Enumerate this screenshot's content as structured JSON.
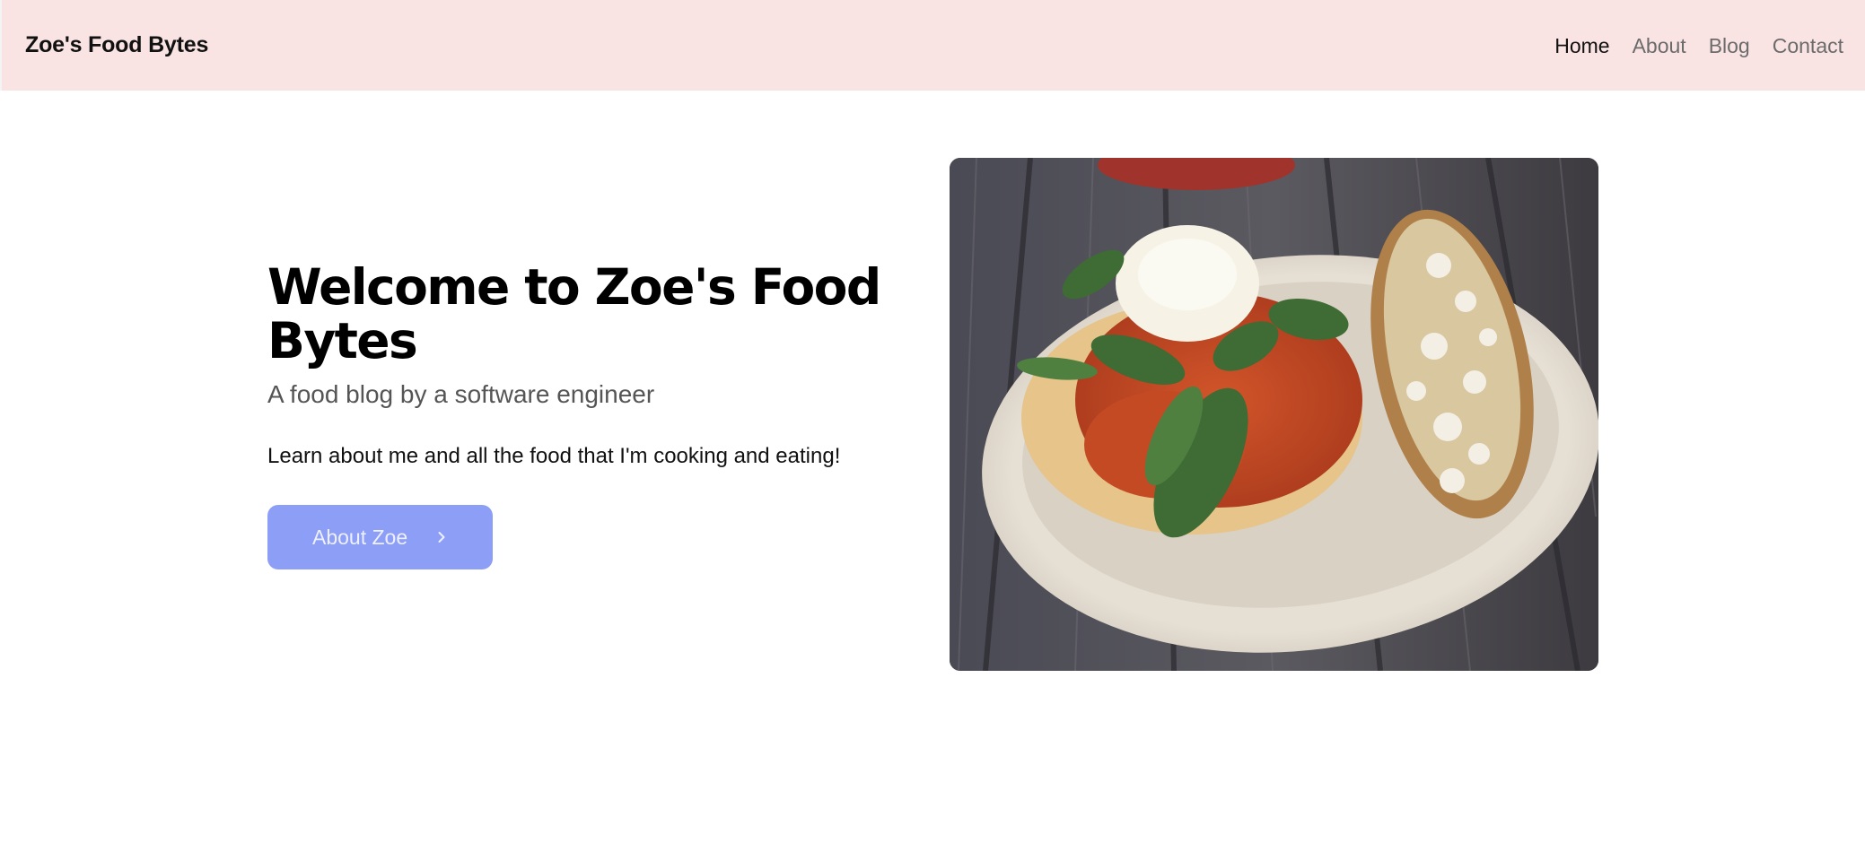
{
  "navbar": {
    "brand": "Zoe's Food Bytes",
    "links": [
      {
        "label": "Home",
        "active": true
      },
      {
        "label": "About",
        "active": false
      },
      {
        "label": "Blog",
        "active": false
      },
      {
        "label": "Contact",
        "active": false
      }
    ]
  },
  "hero": {
    "title": "Welcome to Zoe's Food Bytes",
    "subtitle": "A food blog by a software engineer",
    "lead": "Learn about me and all the food that I'm cooking and eating!",
    "cta_label": "About Zoe",
    "cta_icon": "chevron-right-icon"
  },
  "colors": {
    "navbar_bg": "#f9e4e3",
    "cta_bg": "#8c9ef6",
    "subtitle": "#555555",
    "nav_inactive": "#6b6b6b"
  }
}
